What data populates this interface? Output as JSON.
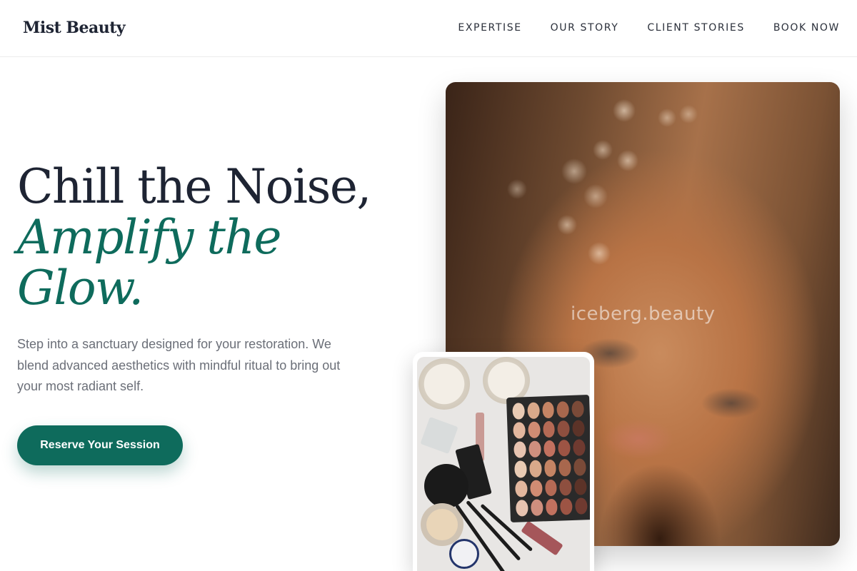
{
  "brand": {
    "name": "Mist Beauty"
  },
  "nav": {
    "items": [
      {
        "label": "EXPERTISE"
      },
      {
        "label": "OUR STORY"
      },
      {
        "label": "CLIENT STORIES"
      },
      {
        "label": "BOOK NOW"
      }
    ]
  },
  "hero": {
    "title_line1": "Chill the Noise,",
    "title_line2": "Amplify the",
    "title_line3": "Glow.",
    "description": "Step into a sanctuary designed for your restoration. We blend advanced aesthetics with mindful ritual to bring out your most radiant self.",
    "cta_label": "Reserve Your Session"
  },
  "images": {
    "main_watermark": "iceberg.beauty"
  },
  "colors": {
    "accent": "#0e6b5c",
    "text_dark": "#1e2433",
    "text_muted": "#6b6f78"
  }
}
